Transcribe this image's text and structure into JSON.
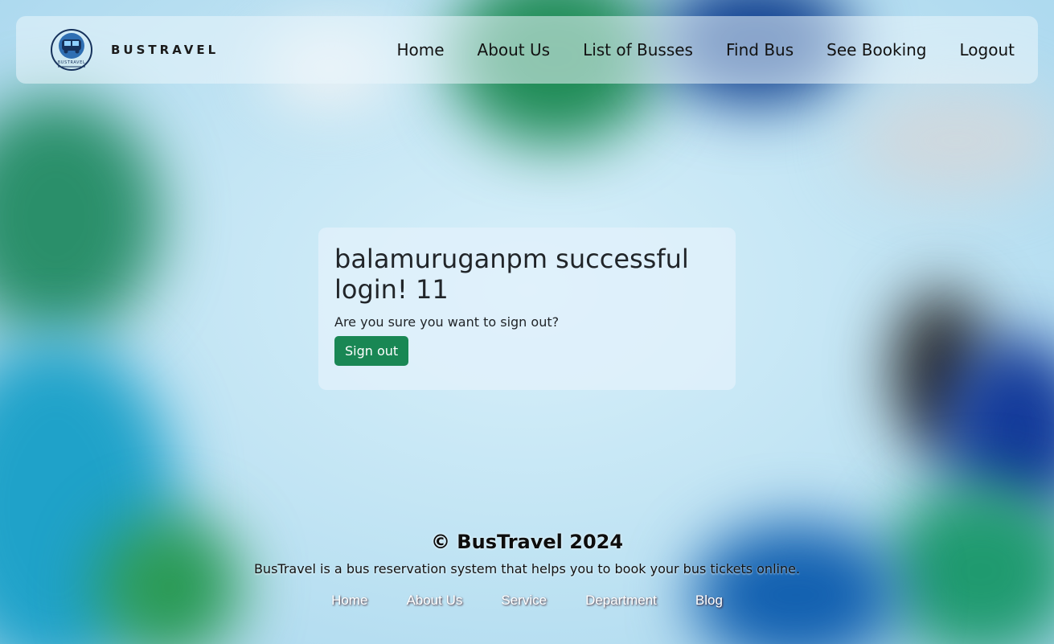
{
  "brand": {
    "name": "BUSTRAVEL",
    "logo_icon": "bus-logo-icon",
    "logo_text": "BUSTRAVEL"
  },
  "nav": {
    "items": [
      {
        "label": "Home"
      },
      {
        "label": "About Us"
      },
      {
        "label": "List of Busses"
      },
      {
        "label": "Find Bus"
      },
      {
        "label": "See Booking"
      },
      {
        "label": "Logout"
      }
    ]
  },
  "card": {
    "title": "balamuruganpm successful login! 11",
    "message": "Are you sure you want to sign out?",
    "button_label": "Sign out",
    "button_color": "#198754"
  },
  "footer": {
    "copyright": "© BusTravel 2024",
    "description": "BusTravel is a bus reservation system that helps you to book your bus tickets online.",
    "links": [
      {
        "label": "Home"
      },
      {
        "label": "About Us"
      },
      {
        "label": "Service"
      },
      {
        "label": "Department"
      },
      {
        "label": "Blog"
      }
    ]
  },
  "colors": {
    "accent_green": "#198754",
    "navbar_bg": "#e9f5fb",
    "background": "#c9e8f5"
  }
}
